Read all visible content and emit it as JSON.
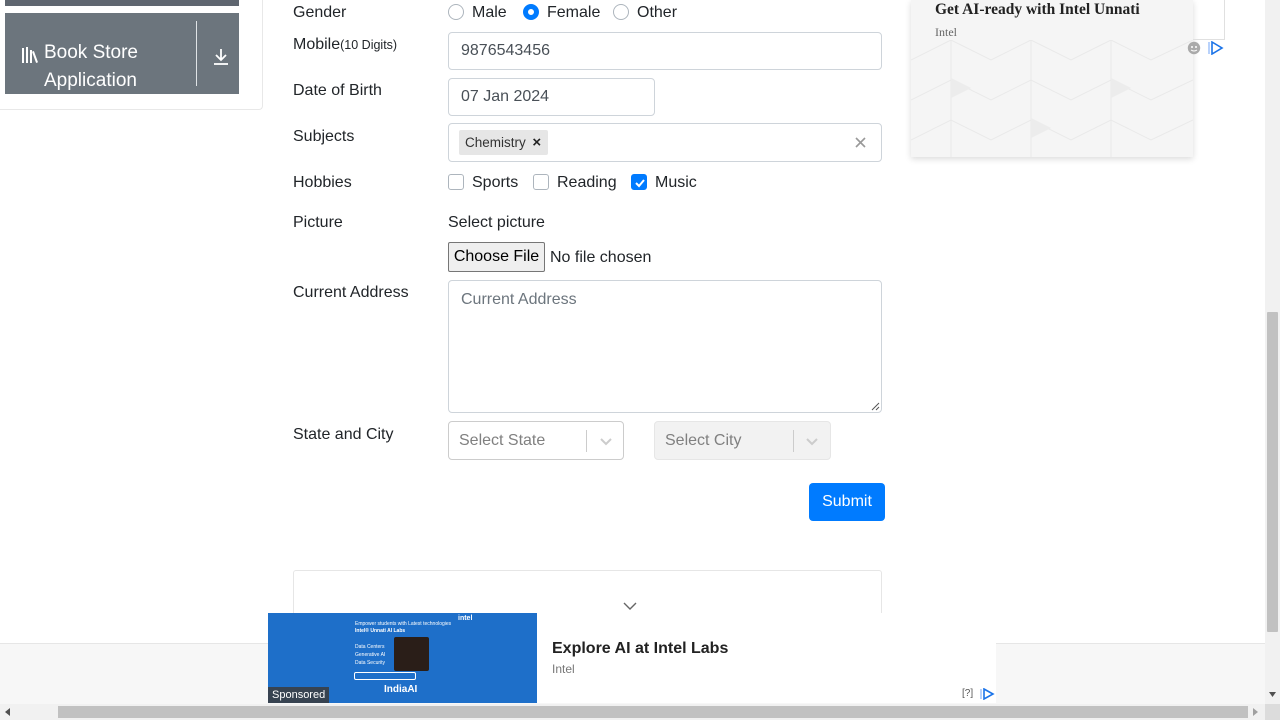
{
  "sidebar": {
    "group_label": "Book Store Application"
  },
  "form": {
    "gender": {
      "label": "Gender",
      "options": [
        "Male",
        "Female",
        "Other"
      ],
      "selected": "Female"
    },
    "mobile": {
      "label": "Mobile",
      "hint": "(10 Digits)",
      "value": "9876543456"
    },
    "dob": {
      "label": "Date of Birth",
      "value": "07 Jan 2024"
    },
    "subjects": {
      "label": "Subjects",
      "tags": [
        "Chemistry"
      ]
    },
    "hobbies": {
      "label": "Hobbies",
      "options": [
        {
          "label": "Sports",
          "checked": false
        },
        {
          "label": "Reading",
          "checked": false
        },
        {
          "label": "Music",
          "checked": true
        }
      ]
    },
    "picture": {
      "label": "Picture",
      "caption": "Select picture",
      "button": "Choose File",
      "status": "No file chosen"
    },
    "address": {
      "label": "Current Address",
      "placeholder": "Current Address"
    },
    "state_city": {
      "label": "State and City",
      "state_placeholder": "Select State",
      "city_placeholder": "Select City"
    },
    "submit_label": "Submit"
  },
  "ads": {
    "right": {
      "title": "Get AI-ready with Intel Unnati",
      "advertiser": "Intel"
    },
    "bottom": {
      "title": "Explore AI at Intel Labs",
      "advertiser": "Intel",
      "sponsored": "Sponsored",
      "info": "[?]",
      "image_lines": [
        "Empower students with Latest technologies",
        "Intel® Unnati AI Labs",
        "Data Centers",
        "Generative AI",
        "Data Security",
        "intel",
        "IndiaAI"
      ]
    }
  },
  "colors": {
    "primary": "#007bff",
    "sidebar_bg": "#6c757d",
    "ad_blue": "#1e6fc9"
  }
}
